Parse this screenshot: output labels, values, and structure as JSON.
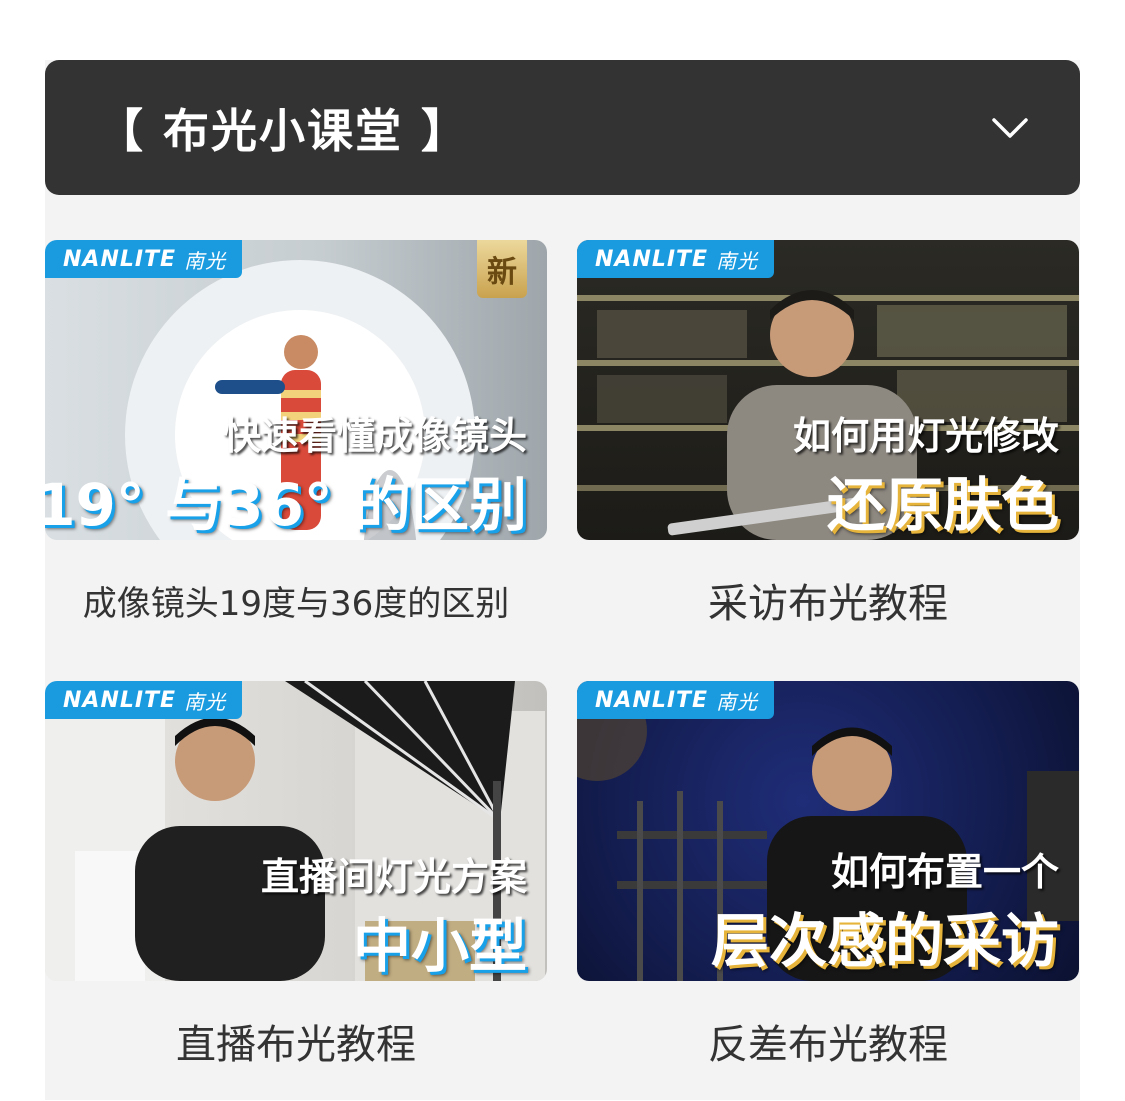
{
  "section": {
    "title": "【 布光小课堂 】",
    "toggle_icon": "chevron-down-icon"
  },
  "brand": {
    "name": "NANLITE",
    "cn": "南光",
    "color": "#1a9be0"
  },
  "videos": [
    {
      "caption": "成像镜头19度与36度的区别",
      "badge": "新",
      "overlay_line1": "快速看懂成像镜头",
      "overlay_line2": "19° 与36° 的区别"
    },
    {
      "caption": "采访布光教程",
      "overlay_line1": "如何用灯光修改",
      "overlay_line2": "还原肤色"
    },
    {
      "caption": "直播布光教程",
      "overlay_line1": "直播间灯光方案",
      "overlay_line2": "中小型"
    },
    {
      "caption": "反差布光教程",
      "overlay_line1": "如何布置一个",
      "overlay_line2": "层次感的采访"
    }
  ]
}
